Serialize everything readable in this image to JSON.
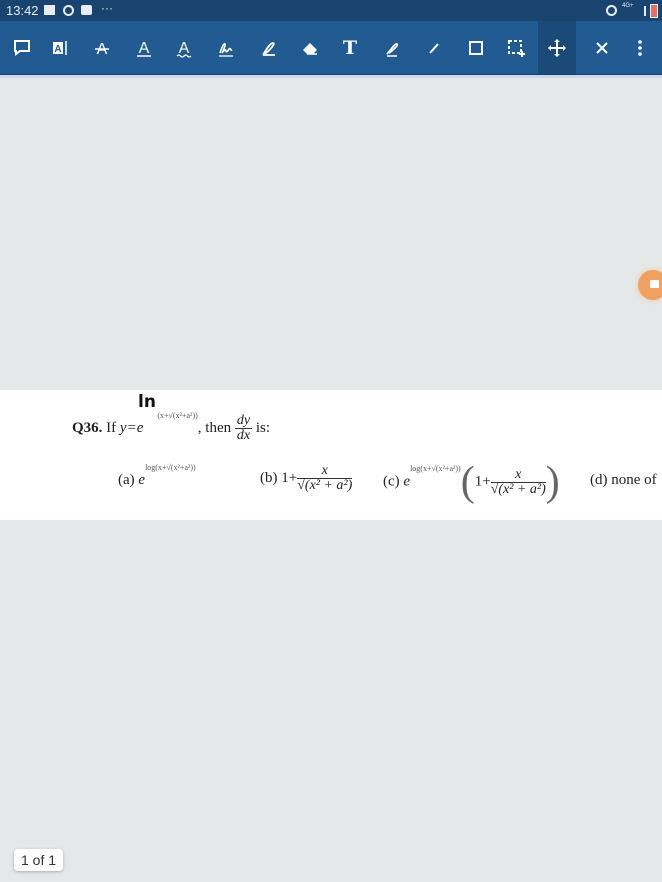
{
  "status_bar": {
    "time": "13:42",
    "left_icons": [
      "gallery-icon",
      "sync-icon",
      "camera-icon"
    ],
    "more": "···",
    "right_icons": [
      "alarm-icon",
      "4g-icon",
      "signal-icon",
      "battery-icon"
    ],
    "network": "4G+"
  },
  "toolbar": {
    "buttons": [
      {
        "name": "comment-tool",
        "icon": "comment-icon"
      },
      {
        "name": "text-box-tool",
        "icon": "text-box-icon"
      },
      {
        "name": "strikethrough-tool",
        "icon": "strikethrough-icon"
      },
      {
        "name": "underline-tool",
        "icon": "underline-icon"
      },
      {
        "name": "squiggly-tool",
        "icon": "squiggly-icon"
      },
      {
        "name": "signature-tool",
        "icon": "signature-icon"
      },
      {
        "name": "pen-tool",
        "icon": "pen-icon"
      },
      {
        "name": "eraser-tool",
        "icon": "eraser-icon"
      },
      {
        "name": "text-tool",
        "icon": "text-icon",
        "label": "T"
      },
      {
        "name": "freehand-tool",
        "icon": "freehand-icon"
      },
      {
        "name": "line-tool",
        "icon": "line-icon"
      },
      {
        "name": "rectangle-tool",
        "icon": "rectangle-icon"
      },
      {
        "name": "area-select-tool",
        "icon": "area-select-icon"
      },
      {
        "name": "pan-tool",
        "icon": "move-icon",
        "active": true
      },
      {
        "name": "close-tool",
        "icon": "close-icon"
      },
      {
        "name": "more-tool",
        "icon": "more-icon"
      }
    ]
  },
  "document": {
    "question_number": "Q36.",
    "question_prefix": "If",
    "y_equals": "y=e",
    "handwritten_annotation": "ln",
    "exponent": "(x+√(x²+a²))",
    "then": ", then",
    "dy": "dy",
    "dx": "dx",
    "is": "is:",
    "options": {
      "a_label": "(a)",
      "a_base": "e",
      "a_exponent": "log(x+√(x²+a²))",
      "b_label": "(b)",
      "b_text": "1+",
      "b_num": "x",
      "b_den": "√(x² + a²)",
      "c_label": "(c)",
      "c_base": "e",
      "c_exponent": "log(x+√(x²+a²))",
      "c_text": "1+",
      "c_num": "x",
      "c_den": "√(x² + a²)",
      "d_label": "(d)",
      "d_text": "none of"
    }
  },
  "page_indicator": "1 of 1",
  "colors": {
    "status_bar": "#1a4470",
    "toolbar": "#225b91",
    "toolbar_active": "#1b4a78",
    "background": "#e4e8e8",
    "fab": "#f0a060"
  }
}
